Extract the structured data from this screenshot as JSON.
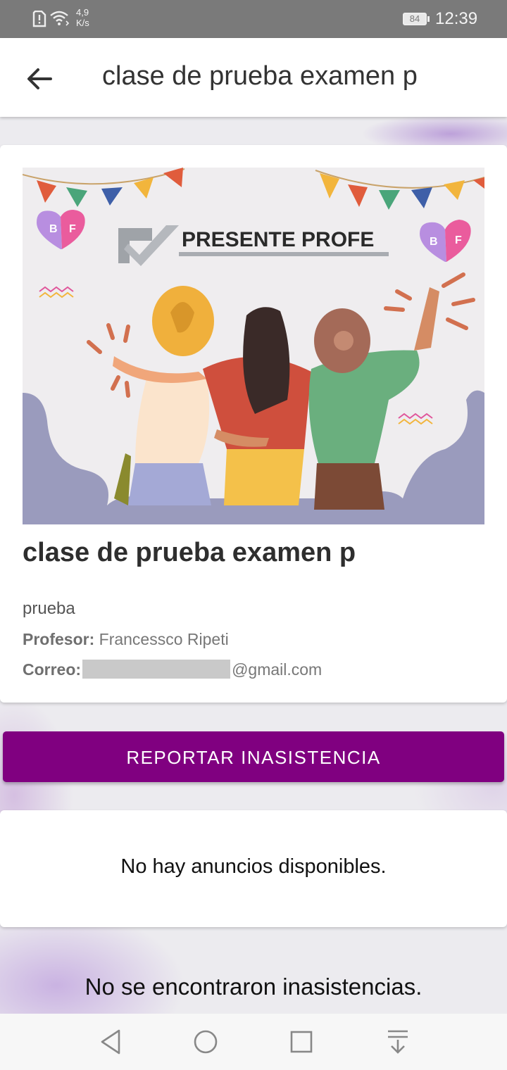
{
  "status_bar": {
    "net_speed_value": "4,9",
    "net_speed_unit": "K/s",
    "battery": "84",
    "time": "12:39",
    "icons": [
      "alert-sim-icon",
      "wifi-icon",
      "battery-icon"
    ]
  },
  "app_bar": {
    "back_icon": "arrow-left-icon",
    "title": "clase de prueba examen p"
  },
  "class_card": {
    "banner": {
      "brand_text": "PRESENTE PROFE",
      "heart_letters": [
        "B",
        "F"
      ]
    },
    "title": "clase de prueba examen p",
    "description": "prueba",
    "teacher_label": "Profesor:",
    "teacher_name": "Francessco Ripeti",
    "email_label": "Correo:",
    "email_domain": "@gmail.com"
  },
  "report_button": {
    "label": "REPORTAR INASISTENCIA"
  },
  "announcements": {
    "empty_text": "No hay anuncios disponibles."
  },
  "absences": {
    "empty_text": "No se encontraron inasistencias."
  },
  "colors": {
    "accent": "#800080",
    "status_bar": "#7a7a7a",
    "banner_bg": "#efedef",
    "banner_blob": "#9a9bbd"
  },
  "nav_bar": {
    "icons": [
      "nav-back-icon",
      "nav-home-icon",
      "nav-recents-icon",
      "nav-menu-down-icon"
    ]
  }
}
